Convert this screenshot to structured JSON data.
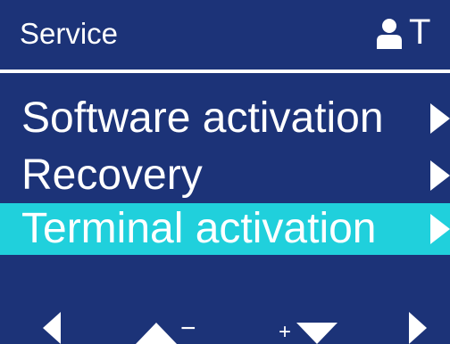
{
  "header": {
    "title": "Service",
    "right_text": "T",
    "user_icon": "user-icon"
  },
  "menu": {
    "items": [
      {
        "label": "Software activation",
        "selected": false,
        "icon": "chevron-right-icon"
      },
      {
        "label": "Recovery",
        "selected": false,
        "icon": "chevron-right-icon"
      },
      {
        "label": "Terminal activation",
        "selected": true,
        "icon": "chevron-right-icon"
      }
    ]
  },
  "footer": {
    "minus": "−",
    "plus": "+",
    "icons": [
      "arrow-left-icon",
      "arrow-up-icon",
      "arrow-down-icon",
      "arrow-right-icon"
    ]
  },
  "colors": {
    "background": "#1c3378",
    "highlight": "#20d0dc",
    "text": "#ffffff"
  }
}
